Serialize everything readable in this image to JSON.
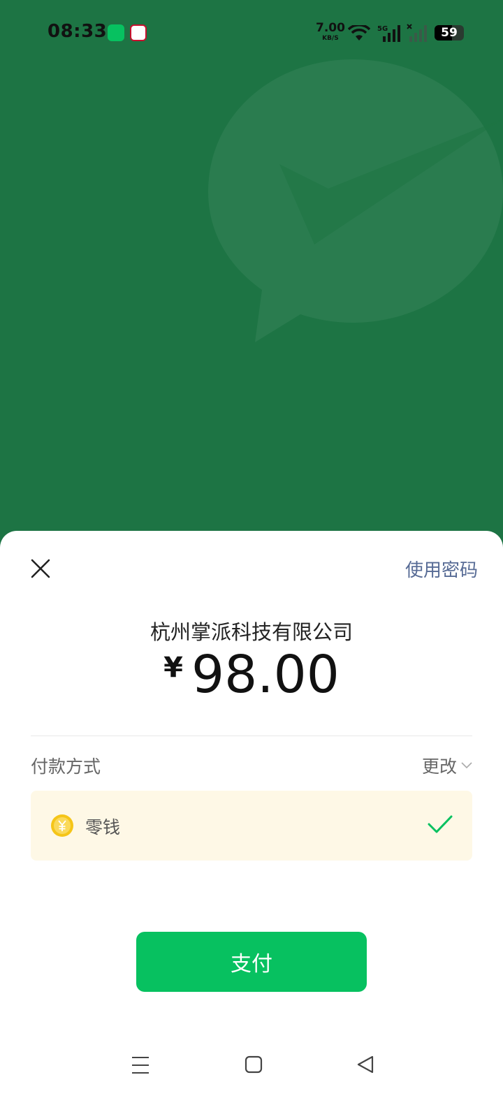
{
  "status_bar": {
    "time": "08:33",
    "net_speed_value": "7.00",
    "net_speed_unit": "KB/S",
    "signal_label": "5G",
    "battery_level": "59",
    "icons": [
      "wechat-icon",
      "bank-app-icon",
      "wifi-icon",
      "signal-5g-icon",
      "signal-no-sim-icon",
      "battery-icon"
    ]
  },
  "sheet": {
    "use_password_label": "使用密码",
    "merchant_name": "杭州掌派科技有限公司",
    "currency_symbol": "¥",
    "amount": "98.00",
    "payment_method_label": "付款方式",
    "change_label": "更改",
    "selected_method": "零钱",
    "pay_button_label": "支付"
  },
  "colors": {
    "background_green": "#1d7444",
    "brand_green": "#07c160",
    "link_blue": "#576b95",
    "card_yellow": "#fef8e6",
    "coin_yellow": "#f5c518"
  }
}
